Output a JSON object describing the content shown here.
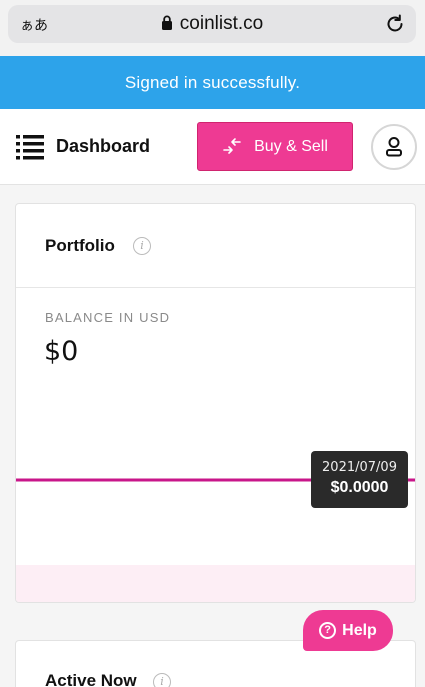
{
  "browser": {
    "text_size_label": "ぁあ",
    "url": "coinlist.co"
  },
  "banner": {
    "message": "Signed in successfully.",
    "color": "#2da3ea"
  },
  "header": {
    "title": "Dashboard",
    "buy_sell_label": "Buy & Sell",
    "accent": "#ee3a93"
  },
  "portfolio": {
    "title": "Portfolio",
    "balance_label": "BALANCE IN USD",
    "balance_value": "$0",
    "chart_data": {
      "type": "line",
      "series": [
        {
          "values": [
            0,
            0
          ]
        }
      ],
      "tooltip_date": "2021/07/09",
      "tooltip_value": "$0.0000"
    }
  },
  "help": {
    "label": "Help"
  },
  "active_now": {
    "title": "Active Now"
  },
  "icons": [
    "lock-icon",
    "reload-icon",
    "menu-icon",
    "swap-arrows-icon",
    "user-icon",
    "info-icon",
    "help-icon"
  ]
}
